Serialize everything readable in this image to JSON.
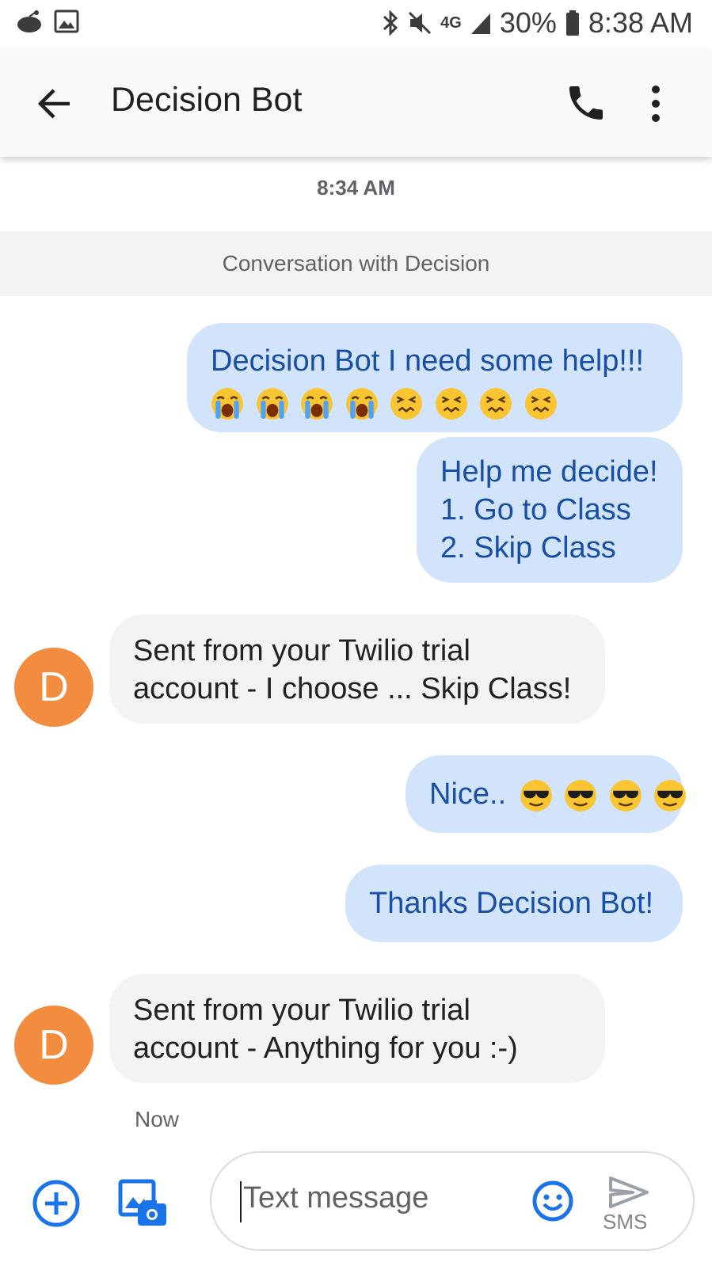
{
  "status_bar": {
    "network": "4G",
    "battery": "30%",
    "time": "8:38 AM"
  },
  "app_bar": {
    "title": "Decision Bot",
    "back_icon": "arrow-back-icon",
    "call_icon": "phone-icon",
    "more_icon": "more-vert-icon"
  },
  "conversation": {
    "timestamp": "8:34 AM",
    "banner": "Conversation with Decision",
    "messages": [
      {
        "direction": "outgoing",
        "lines": [
          "Decision Bot I need some help!!!"
        ],
        "emojis": [
          "loudly-crying-face",
          "loudly-crying-face",
          "loudly-crying-face",
          "loudly-crying-face",
          "confounded-face",
          "confounded-face",
          "confounded-face",
          "confounded-face"
        ]
      },
      {
        "direction": "outgoing",
        "lines": [
          "Help me decide!",
          "1. Go to Class",
          "2. Skip Class"
        ]
      },
      {
        "direction": "incoming",
        "avatar": "D",
        "lines": [
          "Sent from your Twilio trial",
          "account - I choose ... Skip Class!"
        ]
      },
      {
        "direction": "outgoing",
        "lines": [
          "Nice.."
        ],
        "emojis": [
          "sunglasses-face",
          "sunglasses-face",
          "sunglasses-face",
          "sunglasses-face"
        ]
      },
      {
        "direction": "outgoing",
        "lines": [
          "Thanks Decision Bot!"
        ]
      },
      {
        "direction": "incoming",
        "avatar": "D",
        "lines": [
          "Sent from your Twilio trial",
          "account - Anything for you :-)"
        ],
        "time": "Now"
      }
    ]
  },
  "composer": {
    "placeholder": "Text message",
    "send_label": "SMS",
    "add_icon": "add-circle-icon",
    "gallery_icon": "gallery-camera-icon",
    "emoji_icon": "emoji-icon",
    "send_icon": "send-icon"
  },
  "colors": {
    "outgoing_bubble": "#d2e3fc",
    "outgoing_text": "#174ea6",
    "incoming_bubble": "#f1f3f4",
    "avatar": "#f28c3f",
    "accent": "#1a73e8"
  }
}
